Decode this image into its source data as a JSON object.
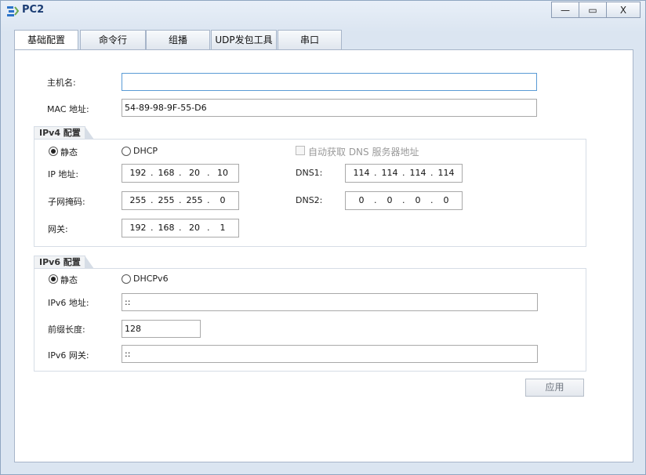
{
  "window": {
    "title": "PC2"
  },
  "titlebar_buttons": {
    "minimize": "—",
    "maximize": "▭",
    "close": "X"
  },
  "tabs": [
    "基础配置",
    "命令行",
    "组播",
    "UDP发包工具",
    "串口"
  ],
  "basic": {
    "hostname_label": "主机名:",
    "hostname_value": "",
    "mac_label": "MAC 地址:",
    "mac_value": "54-89-98-9F-55-D6"
  },
  "ipv4": {
    "group_title": "IPv4 配置",
    "static_label": "静态",
    "dhcp_label": "DHCP",
    "auto_dns_label": "自动获取 DNS 服务器地址",
    "ip_label": "IP 地址:",
    "mask_label": "子网掩码:",
    "gateway_label": "网关:",
    "dns1_label": "DNS1:",
    "dns2_label": "DNS2:",
    "ip": [
      "192",
      "168",
      "20",
      "10"
    ],
    "mask": [
      "255",
      "255",
      "255",
      "0"
    ],
    "gateway": [
      "192",
      "168",
      "20",
      "1"
    ],
    "dns1": [
      "114",
      "114",
      "114",
      "114"
    ],
    "dns2": [
      "0",
      "0",
      "0",
      "0"
    ]
  },
  "ipv6": {
    "group_title": "IPv6 配置",
    "static_label": "静态",
    "dhcp_label": "DHCPv6",
    "addr_label": "IPv6 地址:",
    "addr_value": "::",
    "prefix_label": "前缀长度:",
    "prefix_value": "128",
    "gateway_label": "IPv6 网关:",
    "gateway_value": "::"
  },
  "apply_button": "应用"
}
